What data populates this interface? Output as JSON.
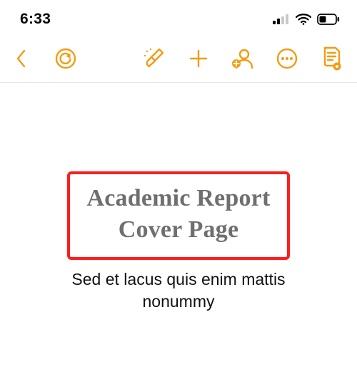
{
  "status_bar": {
    "time": "6:33"
  },
  "toolbar": {
    "back_label": "Back",
    "undo_label": "Undo",
    "format_brush_label": "Format",
    "insert_label": "Insert",
    "collaborate_label": "Collaborate",
    "more_label": "More",
    "document_options_label": "Document Options"
  },
  "document": {
    "title_line1": "Academic Report",
    "title_line2": "Cover Page",
    "subtitle_line1": "Sed et lacus quis enim mattis",
    "subtitle_line2": "nonummy"
  },
  "colors": {
    "accent": "#f39c12",
    "highlight": "#ff1e1e",
    "title_gray": "#6f6f6f"
  }
}
